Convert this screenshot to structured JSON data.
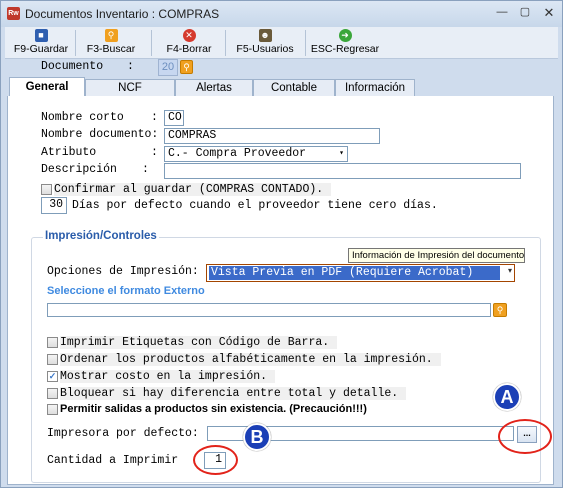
{
  "window": {
    "title": "Documentos Inventario : COMPRAS",
    "app_icon": "app-logo-icon",
    "min": "—",
    "max": "▢",
    "close": "✕"
  },
  "toolbar": {
    "save": {
      "label": "F9-Guardar",
      "icon": "floppy-disk-icon"
    },
    "search": {
      "label": "F3-Buscar",
      "icon": "magnifier-icon"
    },
    "delete": {
      "label": "F4-Borrar",
      "icon": "delete-circle-icon"
    },
    "users": {
      "label": "F5-Usuarios",
      "icon": "users-icon"
    },
    "back": {
      "label": "ESC-Regresar",
      "icon": "green-arrow-icon"
    }
  },
  "document": {
    "label": "Documento",
    "colon": ":",
    "number": "20",
    "search_icon": "magnifier-icon"
  },
  "tabs": [
    {
      "label": "General",
      "active": true
    },
    {
      "label": "NCF",
      "active": false
    },
    {
      "label": "Alertas",
      "active": false
    },
    {
      "label": "Contable",
      "active": false
    },
    {
      "label": "Información",
      "active": false
    }
  ],
  "general": {
    "short_name_label": "Nombre corto",
    "short_name_value": "CO",
    "doc_name_label": "Nombre documento:",
    "doc_name_value": "COMPRAS",
    "attribute_label": "Atributo",
    "attribute_value": "C.- Compra Proveedor",
    "description_label": "Descripción",
    "description_value": "",
    "colon": ":",
    "confirm_label": "Confirmar al guardar (COMPRAS CONTADO).",
    "confirm_checked": false,
    "default_days_value": "30",
    "default_days_label": "Días por defecto cuando el proveedor tiene cero días."
  },
  "print": {
    "group_title": "Impresión/Controles",
    "tooltip": "Información de Impresión del documento",
    "options_label": "Opciones de Impresión:",
    "options_value": "Vista Previa en PDF (Requiere Acrobat)",
    "external_format_label": "Seleccione el formato Externo",
    "external_format_value": "",
    "checkboxes": [
      {
        "label": "Imprimir Etiquetas con Código de Barra.",
        "checked": false
      },
      {
        "label": "Ordenar los productos alfabéticamente en la impresión.",
        "checked": false
      },
      {
        "label": "Mostrar costo en la impresión.",
        "checked": true
      },
      {
        "label": "Bloquear si hay diferencia entre total y detalle.",
        "checked": false
      },
      {
        "label": "Permitir salidas a productos sin existencia. (Precaución!!!)",
        "checked": false
      }
    ],
    "printer_label": "Impresora por defecto:",
    "printer_value": "",
    "printer_browse": "...",
    "quantity_label": "Cantidad a Imprimir",
    "quantity_value": "1"
  },
  "annotations": {
    "a": "A",
    "b": "B",
    "ring_color": "#e2231a",
    "badge_color": "#1b3fb6"
  }
}
